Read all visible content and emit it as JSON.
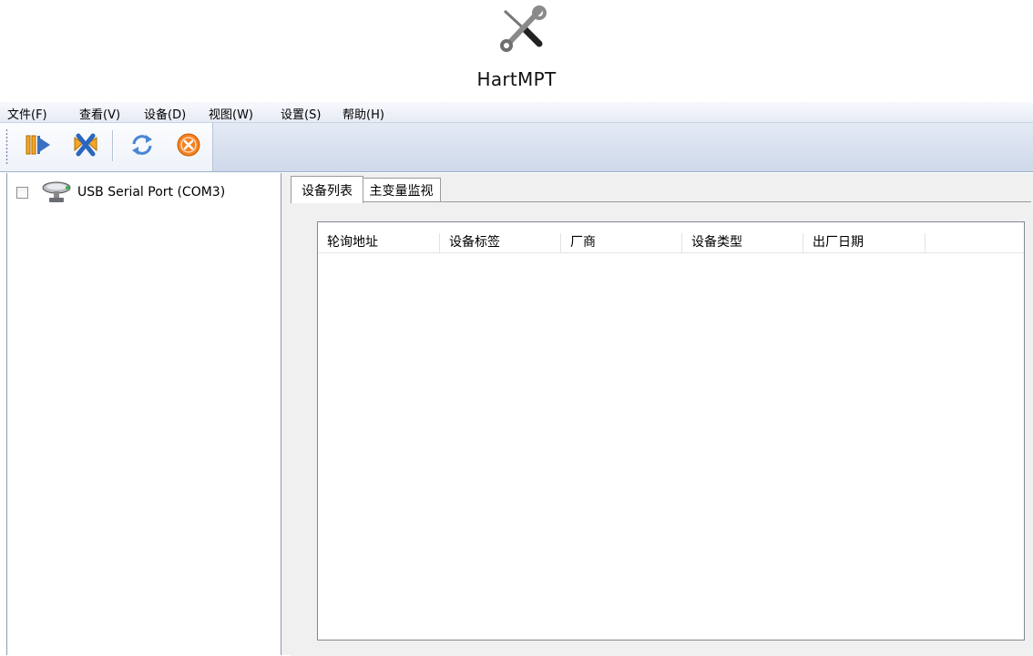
{
  "app": {
    "title": "HartMPT",
    "icon": "tools-icon"
  },
  "menu": [
    "文件(F)",
    "查看(V)",
    "设备(D)",
    "视图(W)",
    "设置(S)",
    "帮助(H)"
  ],
  "toolbar": {
    "buttons": [
      {
        "name": "connect-icon"
      },
      {
        "name": "disconnect-icon"
      },
      {
        "name": "refresh-icon"
      },
      {
        "name": "stop-icon"
      }
    ]
  },
  "tree": {
    "items": [
      {
        "label": "USB Serial Port (COM3)",
        "checked": false,
        "icon": "serial-port-icon"
      }
    ]
  },
  "tabs": [
    {
      "label": "设备列表",
      "active": true
    },
    {
      "label": "主变量监视",
      "active": false
    }
  ],
  "device_list": {
    "columns": [
      "轮询地址",
      "设备标签",
      "厂商",
      "设备类型",
      "出厂日期"
    ],
    "rows": []
  },
  "colors": {
    "toolbar_bg": "#d6dfee",
    "menubar_bg": "#e9eef6",
    "accent_orange": "#f5821f",
    "accent_blue": "#2f73c9"
  }
}
